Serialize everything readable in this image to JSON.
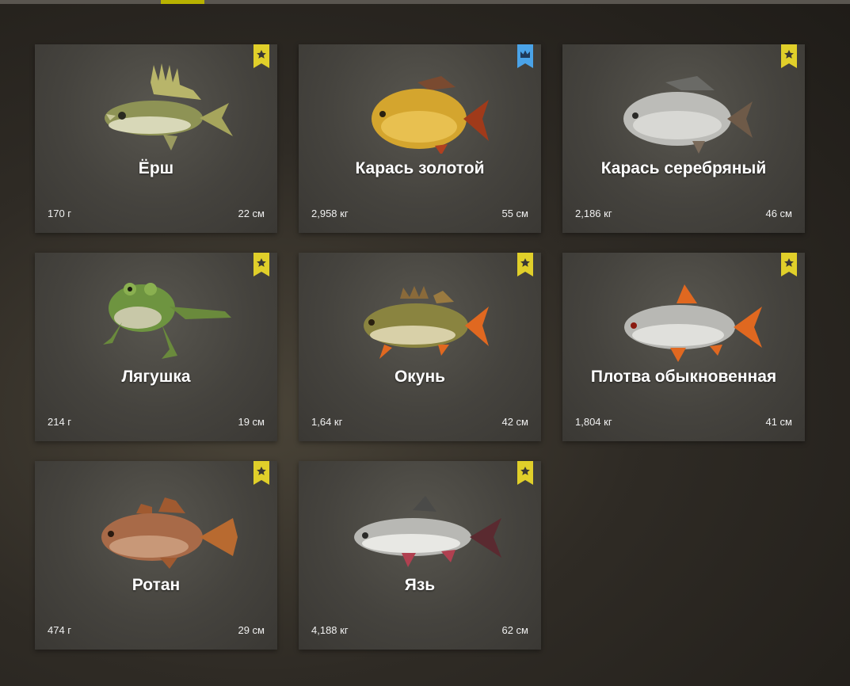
{
  "cards": [
    {
      "name": "Ёрш",
      "weight": "170 г",
      "length": "22 см",
      "badge": "star"
    },
    {
      "name": "Карась золотой",
      "weight": "2,958 кг",
      "length": "55 см",
      "badge": "crown"
    },
    {
      "name": "Карась серебряный",
      "weight": "2,186 кг",
      "length": "46 см",
      "badge": "star"
    },
    {
      "name": "Лягушка",
      "weight": "214 г",
      "length": "19 см",
      "badge": "star"
    },
    {
      "name": "Окунь",
      "weight": "1,64 кг",
      "length": "42 см",
      "badge": "star"
    },
    {
      "name": "Плотва обыкновенная",
      "weight": "1,804 кг",
      "length": "41 см",
      "badge": "star"
    },
    {
      "name": "Ротан",
      "weight": "474 г",
      "length": "29 см",
      "badge": "star"
    },
    {
      "name": "Язь",
      "weight": "4,188 кг",
      "length": "62 см",
      "badge": "star"
    }
  ],
  "colors": {
    "star_badge": "#e0cf2a",
    "crown_badge": "#4aa3e8"
  },
  "icons": [
    "ruffe-icon",
    "golden-carp-icon",
    "silver-carp-icon",
    "frog-icon",
    "perch-icon",
    "roach-icon",
    "rotan-icon",
    "ide-icon",
    "star-icon",
    "crown-icon"
  ]
}
